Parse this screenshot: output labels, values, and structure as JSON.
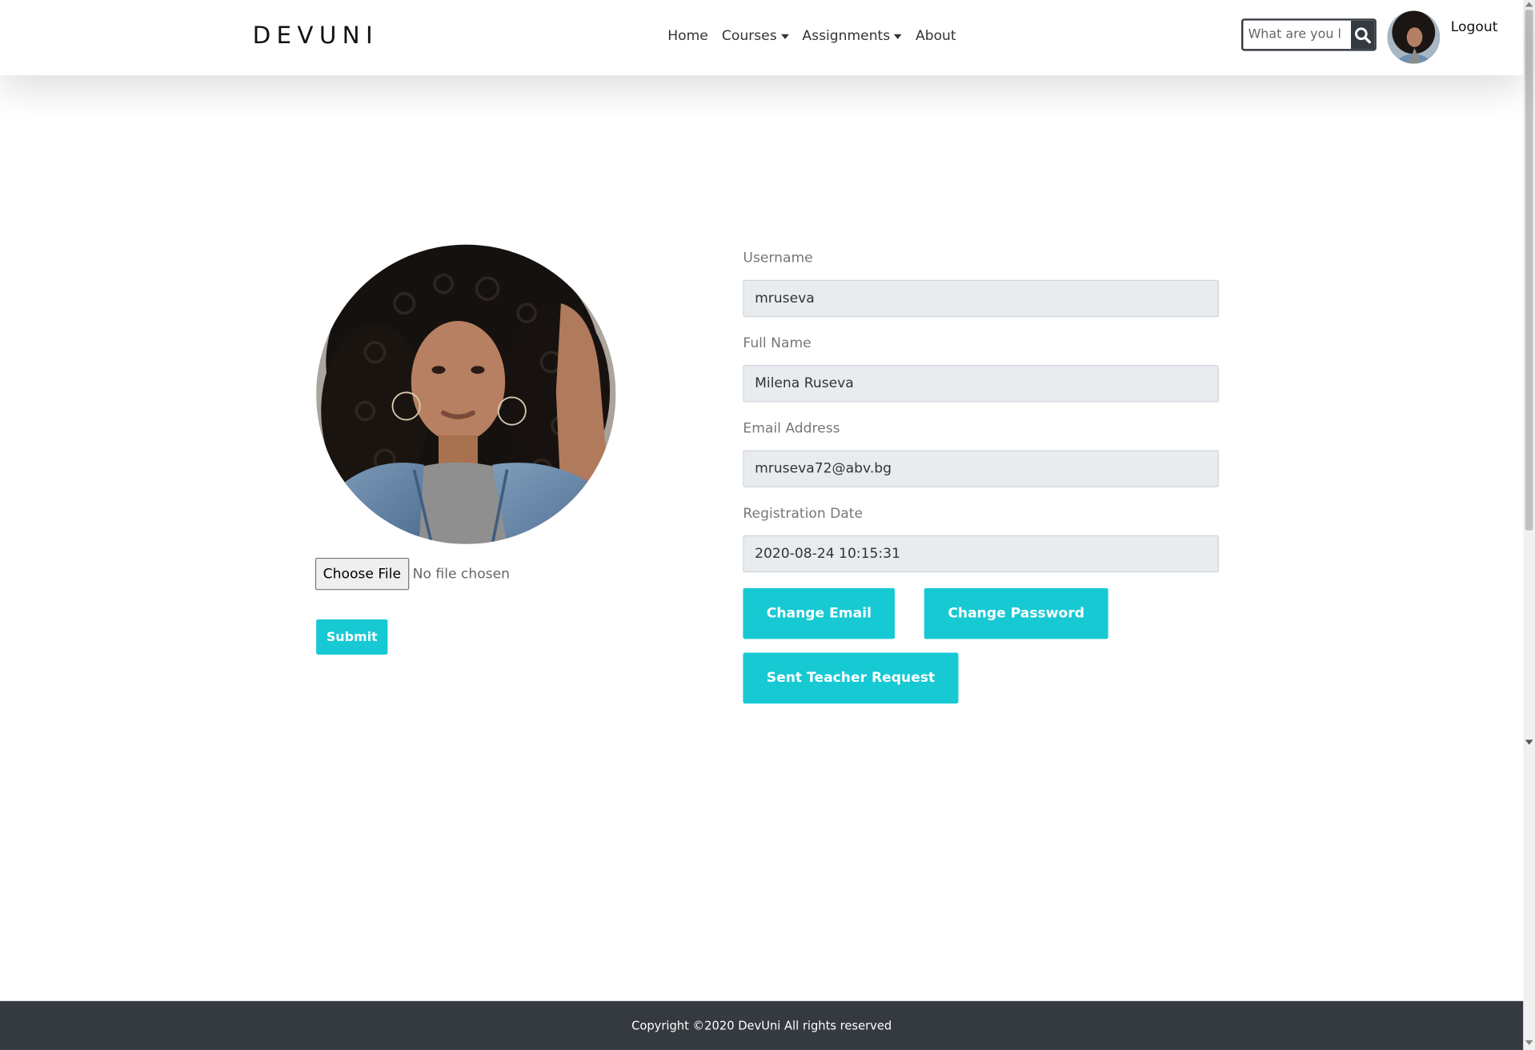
{
  "brand": "DEVUNI",
  "nav": {
    "home": "Home",
    "courses": "Courses",
    "assignments": "Assignments",
    "about": "About"
  },
  "search": {
    "placeholder": "What are you l"
  },
  "user_menu": {
    "logout": "Logout"
  },
  "profile": {
    "choose_file": "Choose File",
    "no_file": "No file chosen",
    "submit": "Submit"
  },
  "form": {
    "username_label": "Username",
    "username_value": "mruseva",
    "fullname_label": "Full Name",
    "fullname_value": "Milena Ruseva",
    "email_label": "Email Address",
    "email_value": "mruseva72@abv.bg",
    "regdate_label": "Registration Date",
    "regdate_value": "2020-08-24 10:15:31"
  },
  "actions": {
    "change_email": "Change Email",
    "change_password": "Change Password",
    "teacher_request": "Sent Teacher Request"
  },
  "footer": {
    "copyright": "Copyright ©2020 DevUni All rights reserved"
  },
  "colors": {
    "accent": "#17c9d3",
    "dark": "#343a40",
    "input_bg": "#e9ecef"
  }
}
